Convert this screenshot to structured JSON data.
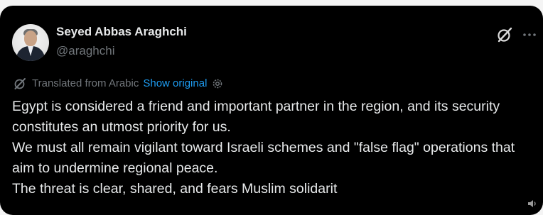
{
  "tweet": {
    "author": {
      "display_name": "Seyed Abbas Araghchi",
      "handle": "@araghchi"
    },
    "translation": {
      "label": "Translated from Arabic",
      "show_original": "Show original"
    },
    "paragraphs": [
      "Egypt is considered a friend and important partner in the region, and its security constitutes an utmost priority for us.",
      "We must all remain vigilant toward Israeli schemes and \"false flag\" operations that aim to undermine regional peace.",
      "The threat is clear, shared, and fears Muslim solidarit"
    ]
  },
  "icons": {
    "grok": "grok-icon",
    "more": "more-horizontal-icon",
    "translate": "translate-icon",
    "settings": "gear-icon"
  },
  "colors": {
    "background": "#000000",
    "text_primary": "#e7e9ea",
    "text_secondary": "#71767b",
    "link": "#1d9bf0"
  }
}
